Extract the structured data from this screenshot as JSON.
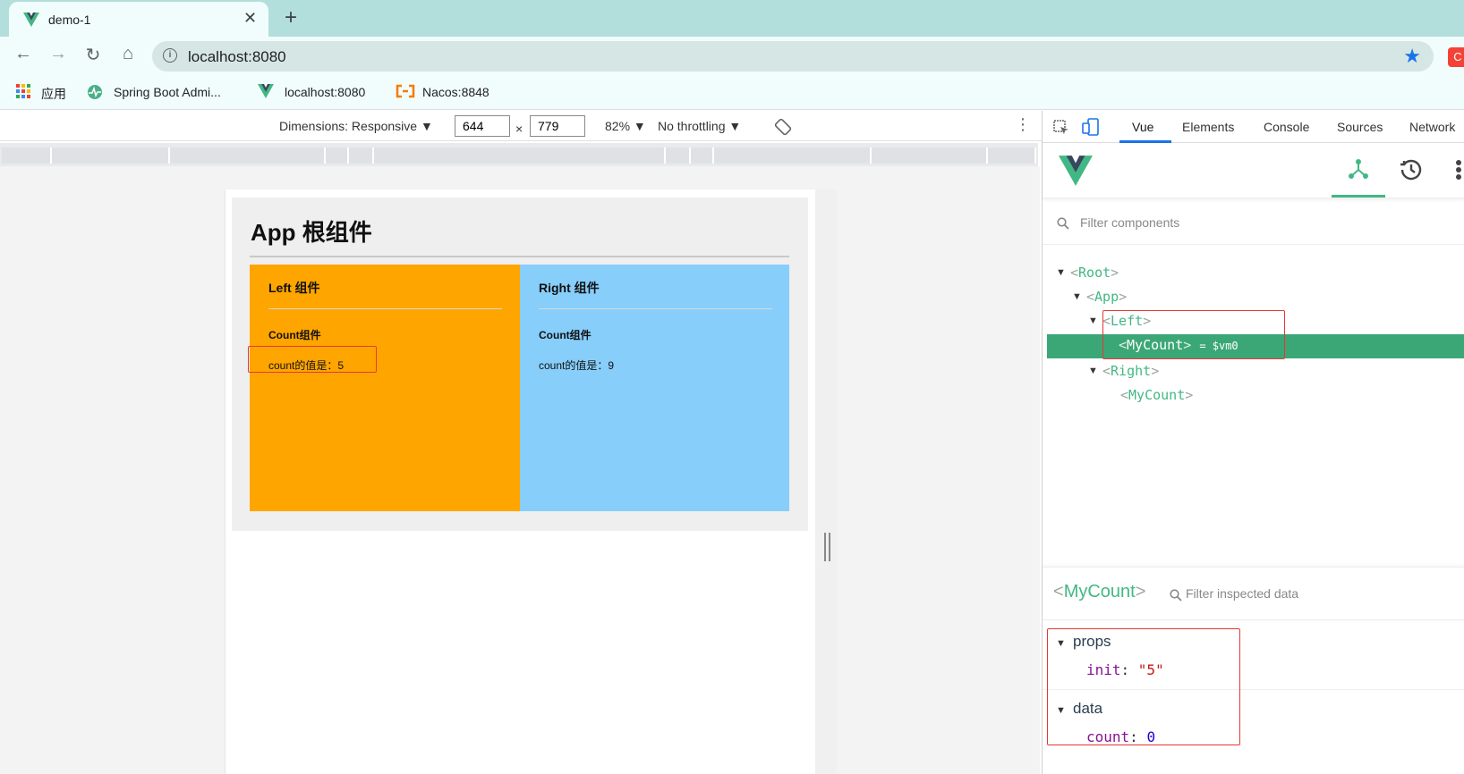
{
  "browser": {
    "tab_title": "demo-1",
    "url": "localhost:8080",
    "bookmarks": [
      {
        "label": "应用",
        "icon": "apps-grid-icon"
      },
      {
        "label": "Spring Boot Admi...",
        "icon": "spring-boot-admin-icon"
      },
      {
        "label": "localhost:8080",
        "icon": "vue-logo-icon"
      },
      {
        "label": "Nacos:8848",
        "icon": "nacos-icon"
      }
    ]
  },
  "device_toolbar": {
    "dimensions_label": "Dimensions: Responsive ▼",
    "width": "644",
    "times": "×",
    "height": "779",
    "zoom": "82% ▼",
    "throttle": "No throttling ▼"
  },
  "app": {
    "title": "App 根组件",
    "left": {
      "title": "Left 组件",
      "count_title": "Count组件",
      "count_text": "count的值是：5"
    },
    "right": {
      "title": "Right 组件",
      "count_title": "Count组件",
      "count_text": "count的值是：9"
    },
    "colors": {
      "left": "#ffa500",
      "right": "#87cefa"
    }
  },
  "devtools": {
    "tabs": [
      "Vue",
      "Elements",
      "Console",
      "Sources",
      "Network"
    ],
    "active_tab": "Vue",
    "filter_components_placeholder": "Filter components",
    "tree": {
      "root": "Root",
      "app": "App",
      "left": "Left",
      "selected": "MyCount",
      "selected_suffix": "= $vm0",
      "right": "Right",
      "right_child": "MyCount"
    },
    "inspector": {
      "component": "MyCount",
      "filter_placeholder": "Filter inspected data",
      "props_label": "props",
      "props": [
        {
          "key": "init",
          "value": "\"5\""
        }
      ],
      "data_label": "data",
      "data": [
        {
          "key": "count",
          "value": "0"
        }
      ]
    },
    "accent": "#42b883"
  }
}
